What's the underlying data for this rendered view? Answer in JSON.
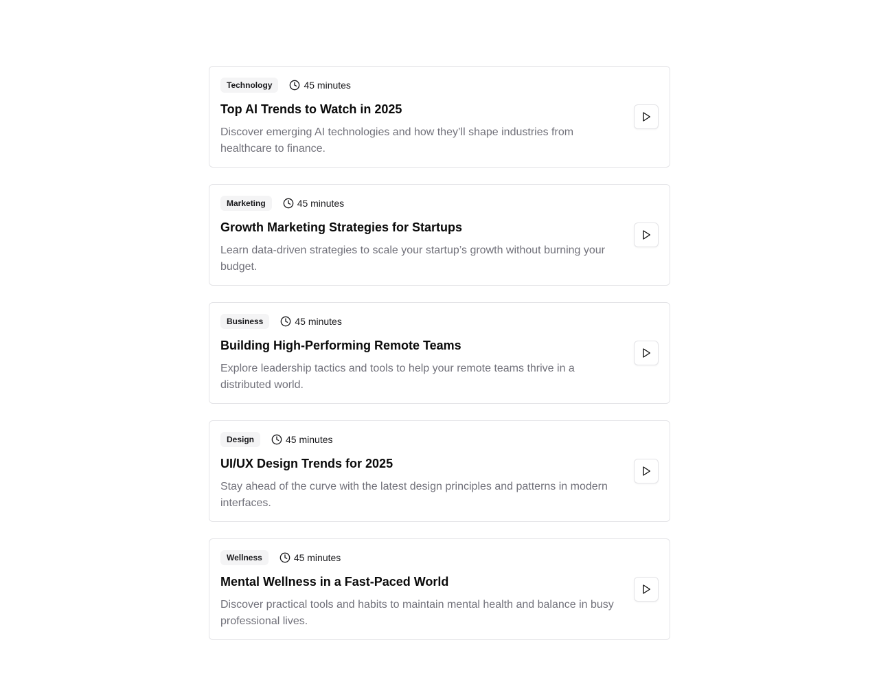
{
  "sessions": [
    {
      "category": "Technology",
      "duration": "45 minutes",
      "title": "Top AI Trends to Watch in 2025",
      "description": "Discover emerging AI technologies and how they’ll shape industries from healthcare to finance."
    },
    {
      "category": "Marketing",
      "duration": "45 minutes",
      "title": "Growth Marketing Strategies for Startups",
      "description": "Learn data-driven strategies to scale your startup’s growth without burning your budget."
    },
    {
      "category": "Business",
      "duration": "45 minutes",
      "title": "Building High-Performing Remote Teams",
      "description": "Explore leadership tactics and tools to help your remote teams thrive in a distributed world."
    },
    {
      "category": "Design",
      "duration": "45 minutes",
      "title": "UI/UX Design Trends for 2025",
      "description": "Stay ahead of the curve with the latest design principles and patterns in modern interfaces."
    },
    {
      "category": "Wellness",
      "duration": "45 minutes",
      "title": "Mental Wellness in a Fast-Paced World",
      "description": "Discover practical tools and habits to maintain mental health and balance in busy professional lives."
    }
  ],
  "icons": {
    "duration": "clock-icon",
    "play": "play-icon"
  },
  "colors": {
    "badge_bg": "#f4f4f5",
    "border": "#e4e4e7",
    "muted_text": "#71717a"
  }
}
